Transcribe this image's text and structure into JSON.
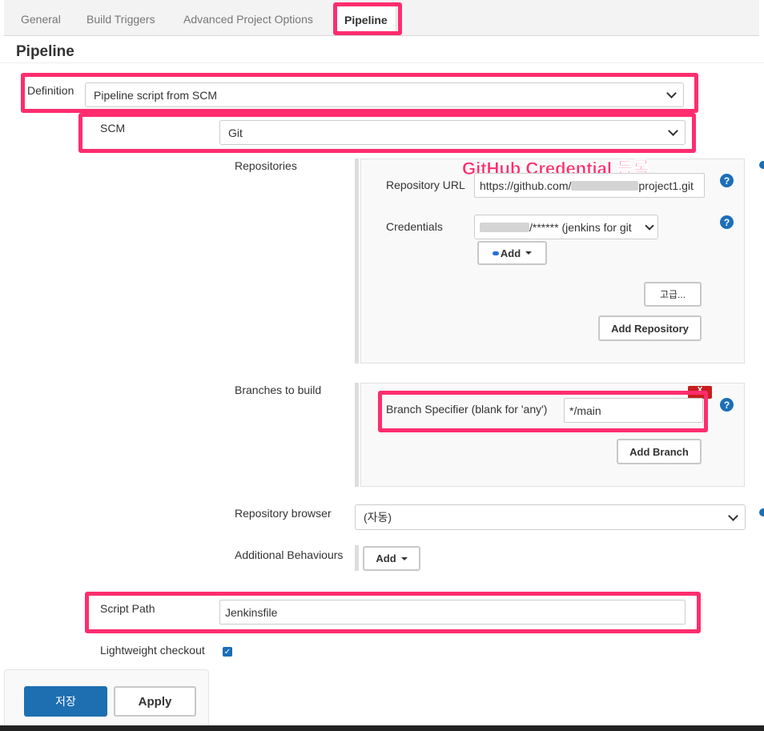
{
  "tabs": {
    "general": "General",
    "build_triggers": "Build Triggers",
    "advanced": "Advanced Project Options",
    "pipeline": "Pipeline"
  },
  "page_title": "Pipeline",
  "definition": {
    "label": "Definition",
    "value": "Pipeline script from SCM"
  },
  "scm": {
    "label": "SCM",
    "value": "Git"
  },
  "repositories": {
    "label": "Repositories",
    "annotation": "GitHub Credential 등록",
    "url_label": "Repository URL",
    "url_prefix": "https://github.com/",
    "url_suffix": "project1.git",
    "credentials_label": "Credentials",
    "credentials_value": "/****** (jenkins for git",
    "add_label": "Add",
    "advanced_label": "고급...",
    "add_repository_label": "Add Repository"
  },
  "branches": {
    "label": "Branches to build",
    "delete_label": "X",
    "specifier_label": "Branch Specifier (blank for 'any')",
    "specifier_value": "*/main",
    "add_branch_label": "Add Branch"
  },
  "repo_browser": {
    "label": "Repository browser",
    "value": "(자동)"
  },
  "additional": {
    "label": "Additional Behaviours",
    "add_label": "Add"
  },
  "script_path": {
    "label": "Script Path",
    "value": "Jenkinsfile"
  },
  "lightweight": {
    "label": "Lightweight checkout",
    "checked": true
  },
  "footer": {
    "save_label": "저장",
    "apply_label": "Apply"
  },
  "help_glyph": "?",
  "colors": {
    "highlight": "#ff2d6e",
    "primary": "#1d6fb1",
    "help": "#1b6eb8"
  },
  "icons": {
    "help": "help-icon",
    "key": "key-icon",
    "caret": "caret-down-icon",
    "chevron": "chevron-down-icon"
  }
}
